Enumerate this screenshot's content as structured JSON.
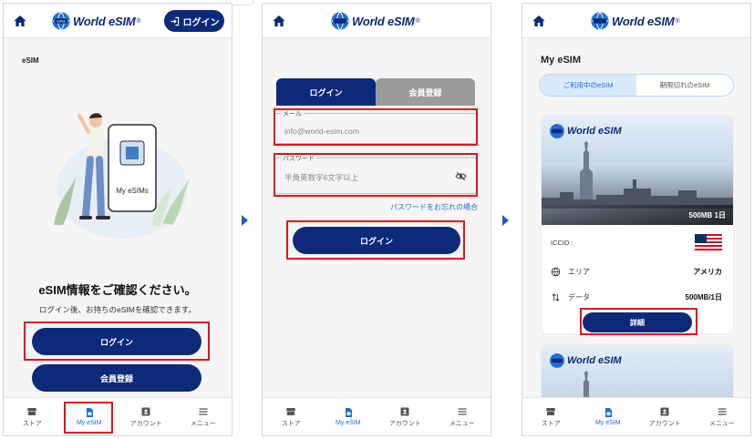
{
  "brand": {
    "name": "World eSIM",
    "registered": "®",
    "chip_text": "eSIM"
  },
  "colors": {
    "primary": "#0d2a7a",
    "accent": "#1c6fd6",
    "highlight": "#e0121f"
  },
  "nav": {
    "items": [
      {
        "label": "ストア",
        "icon": "store-icon"
      },
      {
        "label": "My eSIM",
        "icon": "sim-card-icon"
      },
      {
        "label": "アカウント",
        "icon": "account-icon"
      },
      {
        "label": "メニュー",
        "icon": "menu-icon"
      }
    ]
  },
  "screen1": {
    "header_login": "ログイン",
    "section_label": "eSIM",
    "illustration_label": "My eSIMs",
    "title": "eSIM情報をご確認ください。",
    "subtitle": "ログイン後、お持ちのeSIMを確認できます。",
    "login_button": "ログイン",
    "register_button": "会員登録"
  },
  "screen2": {
    "tabs": [
      "ログイン",
      "会員登録"
    ],
    "email": {
      "label": "メール",
      "placeholder": "info@world-esim.com"
    },
    "password": {
      "label": "パスワード",
      "placeholder": "半角英数字6文字以上"
    },
    "forgot_link": "パスワードをお忘れの場合",
    "login_button": "ログイン"
  },
  "screen3": {
    "title": "My eSIM",
    "segments": [
      "ご利用中のeSIM",
      "期限切れのeSIM"
    ],
    "card": {
      "plan": "500MB 1日",
      "iccid_label": "ICCID :",
      "area_label": "エリア",
      "area_value": "アメリカ",
      "data_label": "データ",
      "data_value": "500MB/1日",
      "detail_button": "詳細"
    }
  }
}
